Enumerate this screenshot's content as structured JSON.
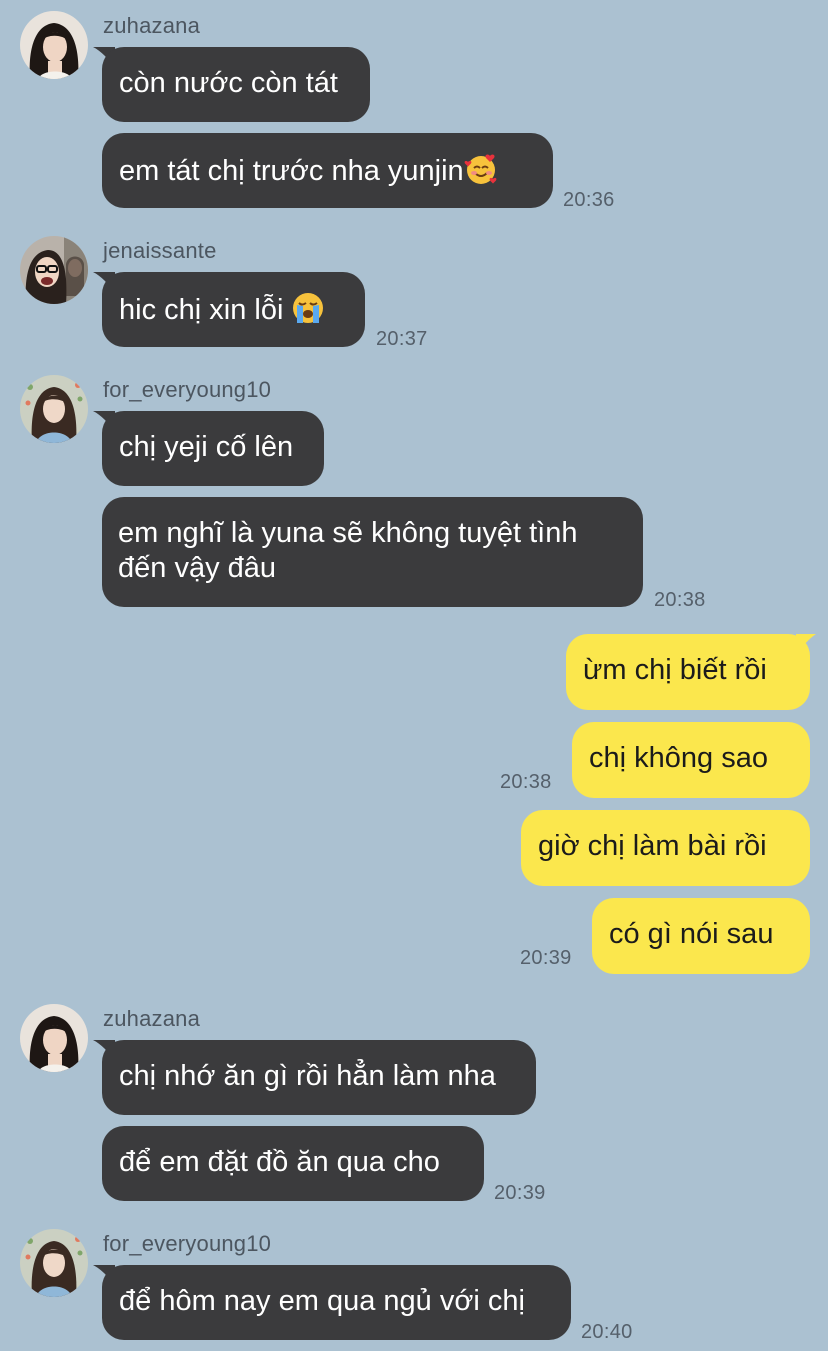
{
  "colors": {
    "background": "#abc1d1",
    "incoming_bubble": "#3b3b3d",
    "outgoing_bubble": "#fbe74d",
    "incoming_text": "#ffffff",
    "outgoing_text": "#1b1b1b",
    "timestamp": "#55606b"
  },
  "groups": [
    {
      "sender": "zuhazana",
      "avatar": "avatar-zuhazana",
      "messages": [
        "còn nước còn tát",
        "em tát chị trước nha yunjin"
      ],
      "emoji": "smiling-face-with-hearts-icon",
      "time": "20:36"
    },
    {
      "sender": "jenaissante",
      "avatar": "avatar-jenaissante",
      "messages": [
        "hic chị xin lỗi"
      ],
      "emoji": "loudly-crying-face-icon",
      "time": "20:37"
    },
    {
      "sender": "for_everyoung10",
      "avatar": "avatar-for-everyoung10",
      "messages": [
        "chị yeji cố lên",
        "em nghĩ là yuna sẽ không tuyệt tình đến vậy đâu"
      ],
      "time": "20:38"
    },
    {
      "sender": "me",
      "messages": [
        "ừm chị biết rồi",
        "chị không sao",
        "giờ chị làm bài rồi",
        "có gì nói sau"
      ],
      "times": [
        "20:38",
        "20:39"
      ]
    },
    {
      "sender": "zuhazana",
      "avatar": "avatar-zuhazana",
      "messages": [
        "chị nhớ ăn gì rồi hẳn làm nha",
        "để em đặt đồ ăn qua cho"
      ],
      "time": "20:39"
    },
    {
      "sender": "for_everyoung10",
      "avatar": "avatar-for-everyoung10",
      "messages": [
        "để hôm nay em qua ngủ với chị"
      ],
      "time": "20:40"
    }
  ]
}
